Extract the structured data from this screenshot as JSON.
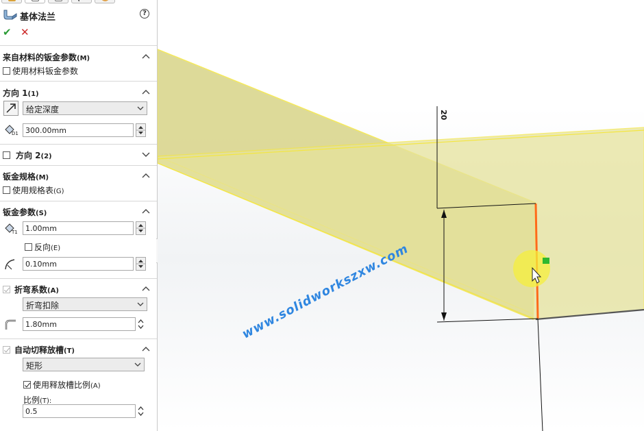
{
  "feature": {
    "title": "基体法兰",
    "help_glyph": "?",
    "ok_glyph": "✔",
    "cancel_glyph": "✕"
  },
  "sections": {
    "material": {
      "title": "来自材料的钣金参数",
      "suffix": "(M)",
      "checkbox_label": "使用材料钣金参数"
    },
    "direction1": {
      "title": "方向 1",
      "suffix": "(1)",
      "end_condition": "给定深度",
      "depth": "300.00mm"
    },
    "direction2": {
      "title": "方向 2",
      "suffix": "(2)"
    },
    "gauge": {
      "title": "钣金规格",
      "suffix": "(M)",
      "checkbox_label": "使用规格表",
      "checkbox_suffix": "(G)"
    },
    "params": {
      "title": "钣金参数",
      "suffix": "(S)",
      "thickness": "1.00mm",
      "reverse_label": "反向",
      "reverse_suffix": "(E)",
      "radius": "0.10mm"
    },
    "bend_allowance": {
      "title": "折弯系数",
      "suffix": "(A)",
      "type": "折弯扣除",
      "value": "1.80mm"
    },
    "relief": {
      "title": "自动切释放槽",
      "suffix": "(T)",
      "type": "矩形",
      "ratio_checkbox_label": "使用释放槽比例",
      "ratio_checkbox_suffix": "(A)",
      "ratio_label": "比例",
      "ratio_label_suffix": "(T):",
      "ratio_value": "0.5"
    }
  },
  "viewport": {
    "dimension_value": "20",
    "watermark": "www.solidworkszxw.com"
  },
  "colors": {
    "part_face": "#d8d488",
    "edge_highlight": "#f4e640",
    "selected_edge": "#ff6a1a",
    "check_green": "#2a9b35",
    "cancel_red": "#cc2a2a",
    "watermark": "#2f86e0"
  }
}
